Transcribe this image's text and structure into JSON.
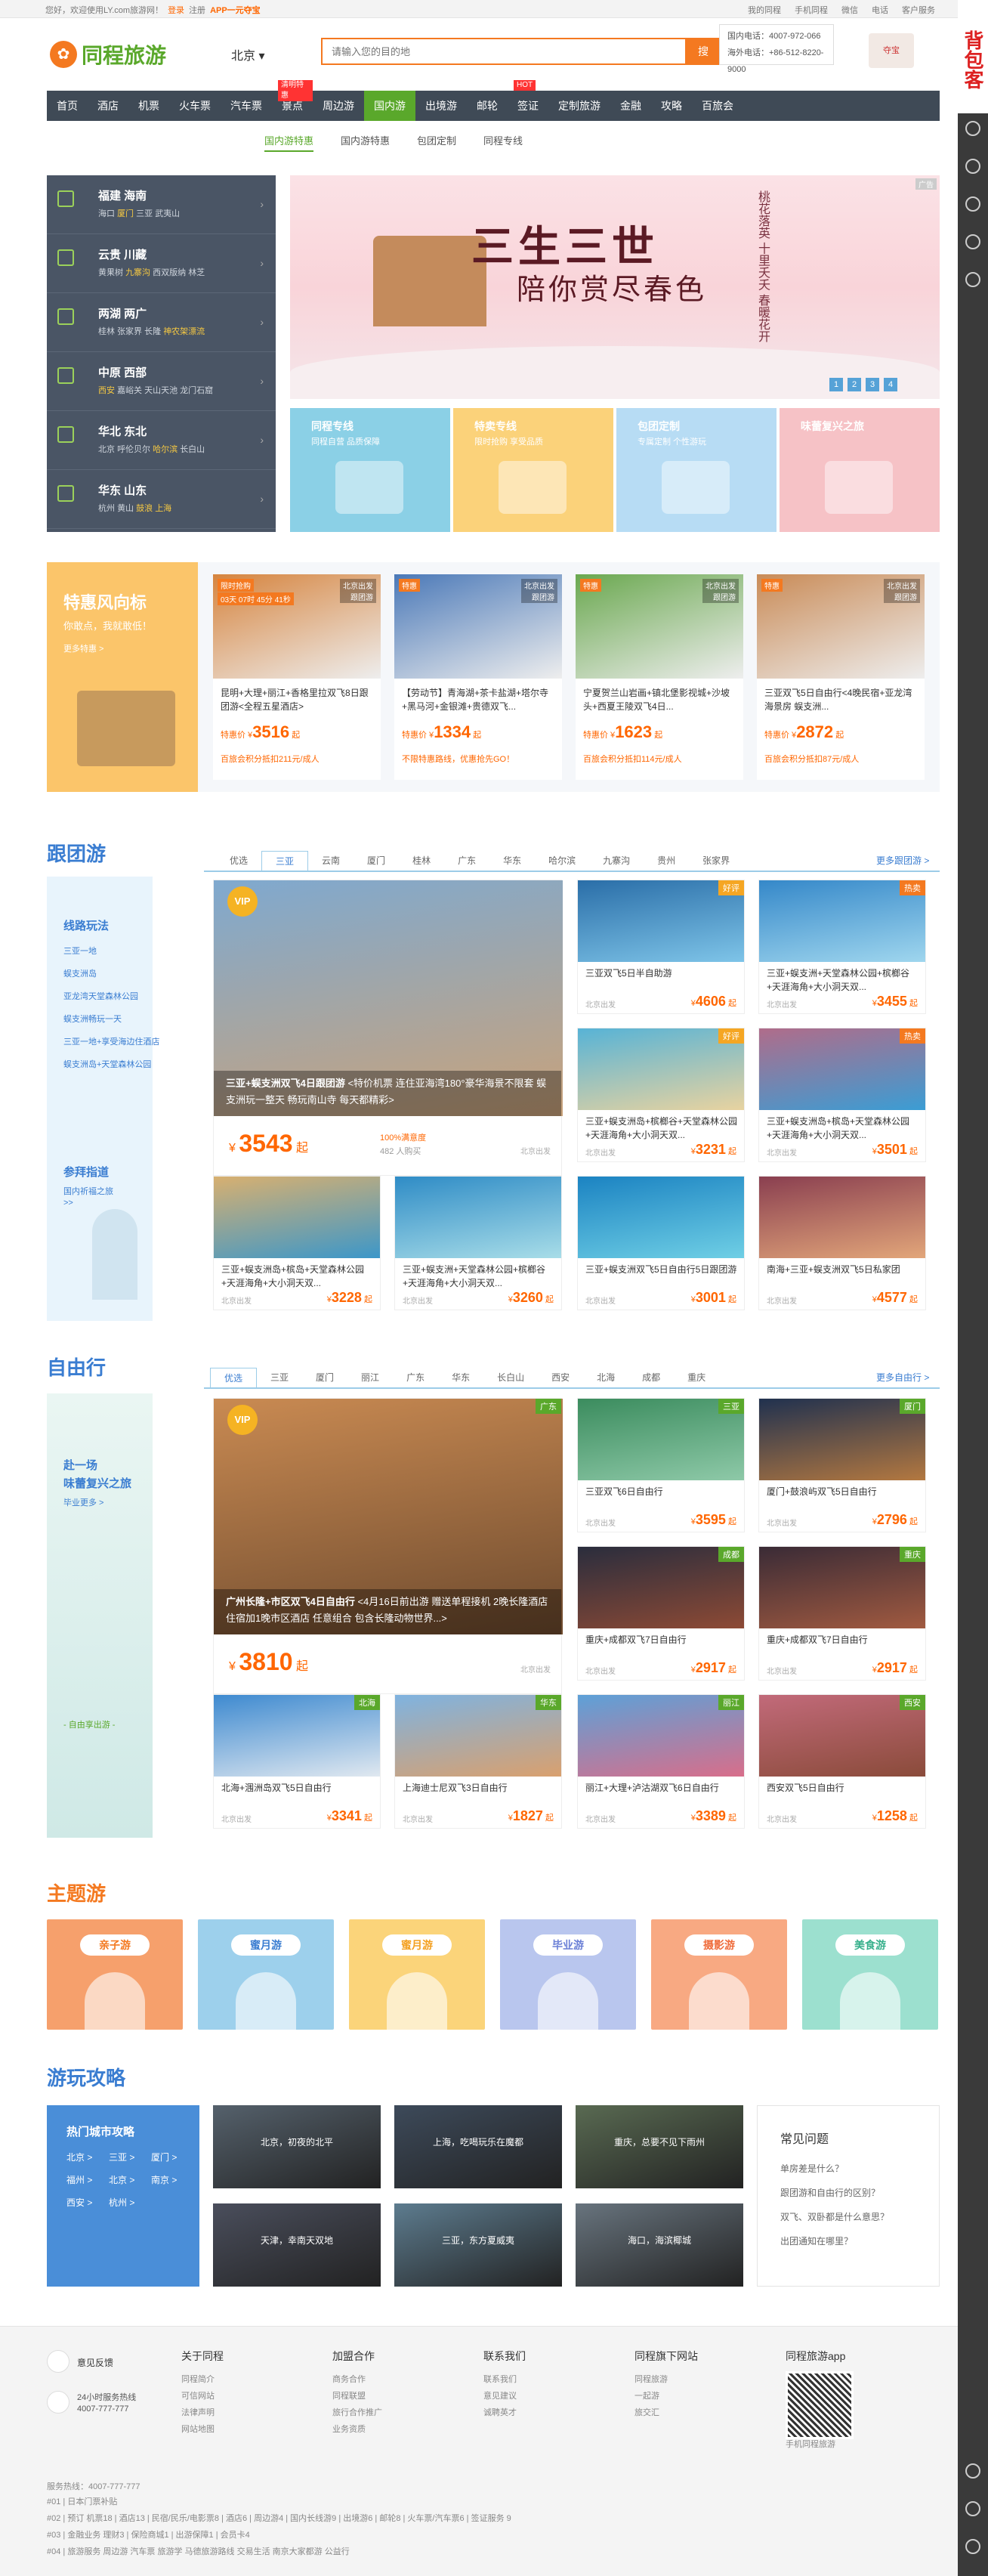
{
  "topbar": {
    "greeting": "您好，欢迎使用LY.com旅游网！",
    "login": "登录",
    "register": "注册",
    "app": "APP一元夺宝",
    "right": [
      "我的同程",
      "手机同程",
      "微信",
      "电话",
      "客户服务"
    ]
  },
  "phone": {
    "domestic": "国内电话：4007-972-066",
    "intl": "海外电话：+86-512-8220-9000"
  },
  "header": {
    "logo_text": "同程旅游",
    "city": "北京",
    "search_placeholder": "请输入您的目的地",
    "search_btn": "搜",
    "promo": "夺宝"
  },
  "nav": [
    {
      "label": "首页"
    },
    {
      "label": "酒店"
    },
    {
      "label": "机票"
    },
    {
      "label": "火车票"
    },
    {
      "label": "汽车票"
    },
    {
      "label": "景点",
      "badge": "清明特惠"
    },
    {
      "label": "周边游"
    },
    {
      "label": "国内游",
      "on": true
    },
    {
      "label": "出境游"
    },
    {
      "label": "邮轮"
    },
    {
      "label": "签证",
      "badge": "HOT"
    },
    {
      "label": "定制旅游"
    },
    {
      "label": "金融"
    },
    {
      "label": "攻略"
    },
    {
      "label": "百旅会"
    }
  ],
  "subnav": [
    "国内游特惠",
    "国内游特惠",
    "包团定制",
    "同程专线"
  ],
  "regions": [
    {
      "name": "福建  海南",
      "cities": [
        "海口",
        "厦门",
        "三亚",
        "武夷山"
      ],
      "hl": [
        1
      ]
    },
    {
      "name": "云贵  川藏",
      "cities": [
        "黄果树",
        "九寨沟",
        "西双版纳",
        "林芝"
      ],
      "hl": [
        1
      ]
    },
    {
      "name": "两湖  两广",
      "cities": [
        "桂林",
        "张家界",
        "长隆",
        "神农架漂流"
      ],
      "hl": [
        3
      ]
    },
    {
      "name": "中原  西部",
      "cities": [
        "西安",
        "嘉峪关",
        "天山天池",
        "龙门石窟"
      ],
      "hl": [
        0
      ]
    },
    {
      "name": "华北  东北",
      "cities": [
        "北京",
        "呼伦贝尔",
        "哈尔滨",
        "长白山"
      ],
      "hl": [
        2
      ]
    },
    {
      "name": "华东  山东",
      "cities": [
        "杭州",
        "黄山",
        "鼓浪",
        "上海"
      ],
      "hl": [
        2,
        3
      ]
    }
  ],
  "banner": {
    "title": "三生三世",
    "subtitle": "陪你赏尽春色",
    "vertical": "桃花落英 十里夭夭 春暖花开",
    "ad": "广告",
    "dots": [
      "1",
      "2",
      "3",
      "4"
    ]
  },
  "tiles": [
    {
      "h": "同程专线",
      "s": "同程自营 品质保障",
      "color": "#8bd0e6"
    },
    {
      "h": "特卖专线",
      "s": "限时抢购 享受品质",
      "color": "#fbd27a"
    },
    {
      "h": "包团定制",
      "s": "专属定制 个性游玩",
      "color": "#b7dcf4"
    },
    {
      "h": "味蕾复兴之旅",
      "s": "",
      "color": "#f6c2c6"
    }
  ],
  "deal": {
    "title": "特惠风向标",
    "sub": "你敢点，我就敢低！",
    "more": "更多特惠 >",
    "cards": [
      {
        "tag": "限时抢购",
        "countdown": "03天 07时 45分 41秒",
        "from": "北京出发\n跟团游",
        "title": "昆明+大理+丽江+香格里拉双飞8日跟团游<全程五星酒店>",
        "price": "3516",
        "note": "百旅会积分抵扣211元/成人",
        "color": "#d6843e"
      },
      {
        "tag": "特惠",
        "from": "北京出发\n跟团游",
        "title": "【劳动节】青海湖+茶卡盐湖+塔尔寺+黑马河+金银滩+贵德双飞...",
        "price": "1334",
        "note": "不限特惠路线，优惠抢先GO！",
        "color": "#4b79b8"
      },
      {
        "tag": "特惠",
        "from": "北京出发\n跟团游",
        "title": "宁夏贺兰山岩画+镇北堡影视城+沙坡头+西夏王陵双飞4日...",
        "price": "1623",
        "note": "百旅会积分抵扣114元/成人",
        "color": "#6aa84f"
      },
      {
        "tag": "特惠",
        "from": "北京出发\n跟团游",
        "title": "三亚双飞5日自由行<4晚民宿+亚龙湾海景房 蜈支洲...",
        "price": "2872",
        "note": "百旅会积分抵扣87元/成人",
        "color": "#c98b57"
      }
    ]
  },
  "group": {
    "title": "跟团游",
    "tabs": [
      "优选",
      "三亚",
      "云南",
      "厦门",
      "桂林",
      "广东",
      "华东",
      "哈尔滨",
      "九寨沟",
      "贵州",
      "张家界"
    ],
    "active": 1,
    "more": "更多跟团游 >",
    "side": {
      "h1": "线路玩法",
      "links": [
        "三亚一地",
        "蜈支洲岛",
        "亚龙湾天堂森林公园",
        "蜈支洲畅玩一天",
        "三亚一地+享受海边住酒店",
        "蜈支洲岛+天堂森林公园"
      ],
      "h2": "参拜指道",
      "sub2": "国内祈福之旅",
      "more2": ">>"
    },
    "big": {
      "title": "三亚+蜈支洲双飞4日跟团游",
      "desc": "<特价机票 连住亚海湾180°豪华海景不限套 蜈支洲玩一整天 畅玩南山寺 每天都精彩>",
      "price": "3543",
      "satisfaction": "100%满意度",
      "bought": "482 人购买",
      "from": "北京出发",
      "vip": "VIP"
    },
    "cards": [
      {
        "title": "三亚双飞5日半自助游",
        "price": "4606",
        "lab": "好评",
        "labc": "#f5a623",
        "c1": "#2a6ea8",
        "c2": "#7ec4e8"
      },
      {
        "title": "三亚+蜈支洲+天堂森林公园+槟榔谷+天涯海角+大小洞天双...",
        "price": "3455",
        "lab": "热卖",
        "labc": "#f47920",
        "c1": "#3588c9",
        "c2": "#9fd6ee"
      },
      {
        "title": "三亚+蜈支洲岛+槟榔谷+天堂森林公园+天涯海角+大小洞天双...",
        "price": "3231",
        "lab": "好评",
        "labc": "#f5a623",
        "c1": "#57b3d6",
        "c2": "#e8d3a0"
      },
      {
        "title": "三亚+蜈支洲岛+槟岛+天堂森林公园+天涯海角+大小洞天双...",
        "price": "3501",
        "lab": "热卖",
        "labc": "#f47920",
        "c1": "#b06c8a",
        "c2": "#3b9dd4"
      },
      {
        "title": "三亚+蜈支洲岛+槟岛+天堂森林公园+天涯海角+大小洞天双...",
        "price": "3228",
        "lab": "",
        "labc": "",
        "c1": "#d8b070",
        "c2": "#3c97c9"
      },
      {
        "title": "三亚+蜈支洲+天堂森林公园+槟榔谷+天涯海角+大小洞天双...",
        "price": "3260",
        "lab": "",
        "labc": "",
        "c1": "#2f8cc6",
        "c2": "#a8dde8"
      },
      {
        "title": "三亚+蜈支洲双飞5日自由行5日跟团游",
        "price": "3001",
        "lab": "",
        "labc": "",
        "c1": "#1b83c2",
        "c2": "#6fcfe5"
      },
      {
        "title": "南海+三亚+蜈支洲双飞5日私家团",
        "price": "4577",
        "lab": "",
        "labc": "",
        "c1": "#8a3f50",
        "c2": "#e2a67a"
      }
    ]
  },
  "free": {
    "title": "自由行",
    "tabs": [
      "优选",
      "三亚",
      "厦门",
      "丽江",
      "广东",
      "华东",
      "长白山",
      "西安",
      "北海",
      "成都",
      "重庆"
    ],
    "active": 0,
    "more": "更多自由行 >",
    "side": {
      "h1": "赴一场",
      "h2": "味蕾复兴之旅",
      "sub": "毕业更多 >",
      "bottom": "- 自由享出游 -"
    },
    "big": {
      "title": "广州长隆+市区双飞4日自由行",
      "desc": "<4月16日前出游 赠送单程接机 2晚长隆酒店住宿加1晚市区酒店 任意组合 包含长隆动物世界...>",
      "price": "3810",
      "from": "北京出发",
      "vip": "VIP",
      "lab": "广东"
    },
    "cards": [
      {
        "title": "三亚双飞6日自由行",
        "price": "3595",
        "lab": "三亚",
        "labc": "#5aa82b",
        "c1": "#3b8c5e",
        "c2": "#8ec9a8"
      },
      {
        "title": "厦门+鼓浪屿双飞5日自由行",
        "price": "2796",
        "lab": "厦门",
        "labc": "#5aa82b",
        "c1": "#20314f",
        "c2": "#b37840"
      },
      {
        "title": "重庆+成都双飞7日自由行",
        "price": "2917",
        "lab": "成都",
        "labc": "#5aa82b",
        "c1": "#2a2d3d",
        "c2": "#8d4a35"
      },
      {
        "title": "重庆+成都双飞7日自由行",
        "price": "2917",
        "lab": "重庆",
        "labc": "#5aa82b",
        "c1": "#3a2b36",
        "c2": "#a15a40"
      },
      {
        "title": "北海+涠洲岛双飞5日自由行",
        "price": "3341",
        "lab": "北海",
        "labc": "#5aa82b",
        "c1": "#3e8ad0",
        "c2": "#e0e8f0"
      },
      {
        "title": "上海迪士尼双飞3日自由行",
        "price": "1827",
        "lab": "华东",
        "labc": "#5aa82b",
        "c1": "#7fb3e0",
        "c2": "#d9a06e"
      },
      {
        "title": "丽江+大理+泸沽湖双飞6日自由行",
        "price": "3389",
        "lab": "丽江",
        "labc": "#5aa82b",
        "c1": "#5da1d8",
        "c2": "#d86e8a"
      },
      {
        "title": "西安双飞5日自由行",
        "price": "1258",
        "lab": "西安",
        "labc": "#5aa82b",
        "c1": "#c26a7a",
        "c2": "#8a4b3a"
      }
    ]
  },
  "theme": {
    "title": "主题游",
    "items": [
      {
        "label": "亲子游",
        "color": "#f6a06c",
        "fc": "#f47920"
      },
      {
        "label": "蜜月游",
        "color": "#9dd0ec",
        "fc": "#3a7dd1"
      },
      {
        "label": "蜜月游",
        "color": "#fbd47a",
        "fc": "#f4a020"
      },
      {
        "label": "毕业游",
        "color": "#b9c6ee",
        "fc": "#6a7fd6"
      },
      {
        "label": "摄影游",
        "color": "#f8a982",
        "fc": "#ef6b3a"
      },
      {
        "label": "美食游",
        "color": "#9ce0cf",
        "fc": "#37b08c"
      }
    ]
  },
  "guide": {
    "title": "游玩攻略",
    "hot": "热门城市攻略",
    "cities": [
      "北京 >",
      "三亚 >",
      "厦门 >",
      "福州 >",
      "北京 >",
      "南京 >",
      "西安 >",
      "杭州 >"
    ],
    "pics": [
      {
        "cap": "北京，初夜的北平",
        "color": "#55616c"
      },
      {
        "cap": "上海，吃喝玩乐在魔都",
        "color": "#3d4a5a"
      },
      {
        "cap": "重庆，总要不见下雨州",
        "color": "#596a52"
      },
      {
        "cap": "天津，幸南天双地",
        "color": "#4a4e5c"
      },
      {
        "cap": "三亚，东方夏威夷",
        "color": "#5d7c8f"
      },
      {
        "cap": "海口，海滨椰城",
        "color": "#68747e"
      }
    ],
    "faq_title": "常见问题",
    "faq": [
      "单房差是什么？",
      "跟团游和自由行的区别？",
      "双飞、双卧都是什么意思？",
      "出团通知在哪里？"
    ]
  },
  "footer": {
    "feedback": "意见反馈",
    "hotline_label": "24小时服务热线",
    "hotline": "4007-777-777",
    "cols": [
      {
        "h": "关于同程",
        "items": [
          "同程简介",
          "可信网站",
          "法律声明",
          "网站地图"
        ]
      },
      {
        "h": "加盟合作",
        "items": [
          "商务合作",
          "同程联盟",
          "旅行合作推广",
          "业务资质"
        ]
      },
      {
        "h": "联系我们",
        "items": [
          "联系我们",
          "意见建议",
          "诚聘英才"
        ]
      },
      {
        "h": "同程旗下网站",
        "items": [
          "同程旅游",
          "一起游",
          "旅交汇"
        ]
      },
      {
        "h": "同程旅游app",
        "items": [
          "手机同程旅游"
        ]
      }
    ],
    "service": "服务热线：4007-777-777",
    "lines": [
      "#01 | 日本门票补贴",
      "#02 | 预订 机票18 | 酒店13 | 民宿/民乐/电影票8 | 酒店6 | 周边游4 | 国内长线游9 | 出境游6 | 邮轮8 | 火车票/汽车票6 | 签证服务 9",
      "#03 | 金融业务 理财3 | 保险商城1 | 出游保障1 | 会员卡4",
      "#04 | 旅游服务 周边游 汽车票 旅游学 马德旅游路线 交易生活 南京大家都游 公益行"
    ]
  }
}
